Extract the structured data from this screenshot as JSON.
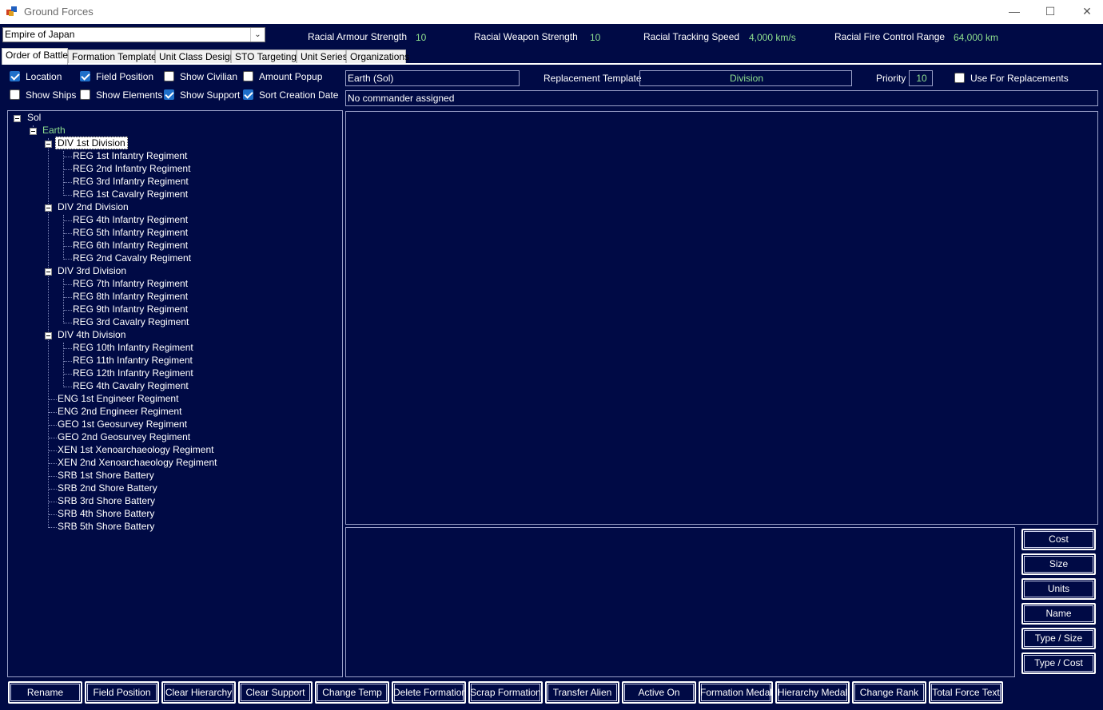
{
  "window": {
    "title": "Ground Forces",
    "controls": {
      "minimize": "—",
      "maximize": "☐",
      "close": "✕"
    }
  },
  "empire_select": {
    "value": "Empire of Japan"
  },
  "stats": {
    "armour_label": "Racial Armour Strength",
    "armour_value": "10",
    "weapon_label": "Racial Weapon Strength",
    "weapon_value": "10",
    "tracking_label": "Racial Tracking Speed",
    "tracking_value": "4,000 km/s",
    "fire_control_label": "Racial Fire Control Range",
    "fire_control_value": "64,000 km"
  },
  "tabs": [
    "Order of Battle",
    "Formation Templates",
    "Unit Class Design",
    "STO Targeting",
    "Unit Series",
    "Organizations"
  ],
  "options": [
    {
      "label": "Location",
      "checked": true
    },
    {
      "label": "Field Position",
      "checked": true
    },
    {
      "label": "Show Civilian",
      "checked": false
    },
    {
      "label": "Amount Popup",
      "checked": false
    },
    {
      "label": "Show Ships",
      "checked": false
    },
    {
      "label": "Show Elements",
      "checked": false
    },
    {
      "label": "Show Support",
      "checked": true
    },
    {
      "label": "Sort Creation Date",
      "checked": true
    }
  ],
  "location_field": "Earth  (Sol)",
  "replacement_label": "Replacement Template",
  "replacement_value": "Division",
  "priority_label": "Priority",
  "priority_value": "10",
  "use_replacements": {
    "label": "Use For Replacements",
    "checked": false
  },
  "commander_field": "No commander assigned",
  "tree": {
    "system": "Sol",
    "body": "Earth",
    "items": [
      "DIV  1st Division",
      "REG  1st Infantry Regiment",
      "REG  2nd Infantry Regiment",
      "REG  3rd Infantry Regiment",
      "REG  1st Cavalry Regiment",
      "DIV  2nd Division",
      "REG  4th Infantry Regiment",
      "REG  5th Infantry Regiment",
      "REG  6th Infantry Regiment",
      "REG  2nd Cavalry Regiment",
      "DIV  3rd Division",
      "REG  7th Infantry Regiment",
      "REG  8th Infantry Regiment",
      "REG  9th Infantry Regiment",
      "REG  3rd Cavalry Regiment",
      "DIV  4th Division",
      "REG  10th Infantry Regiment",
      "REG  11th Infantry Regiment",
      "REG  12th Infantry Regiment",
      "REG  4th Cavalry Regiment",
      "ENG  1st Engineer Regiment",
      "ENG  2nd Engineer Regiment",
      "GEO  1st Geosurvey Regiment",
      "GEO  2nd Geosurvey Regiment",
      "XEN  1st Xenoarchaeology Regiment",
      "XEN  2nd Xenoarchaeology Regiment",
      "SRB  1st Shore Battery",
      "SRB  2nd Shore Battery",
      "SRB  3rd Shore Battery",
      "SRB  4th Shore Battery",
      "SRB  5th Shore Battery"
    ]
  },
  "sort_buttons": [
    "Cost",
    "Size",
    "Units",
    "Name",
    "Type / Size",
    "Type / Cost"
  ],
  "action_buttons": [
    "Rename",
    "Field Position",
    "Clear Hierarchy",
    "Clear Support",
    "Change Temp",
    "Delete Formation",
    "Scrap Formation",
    "Transfer Alien",
    "Active On",
    "Formation Medal",
    "Hierarchy Medal",
    "Change Rank",
    "Total Force Text"
  ]
}
